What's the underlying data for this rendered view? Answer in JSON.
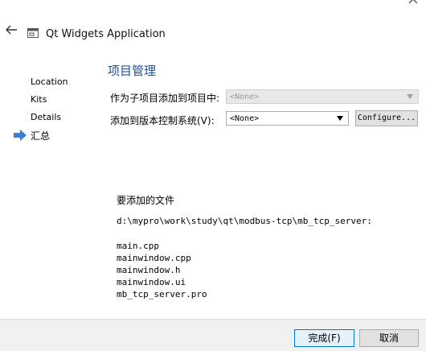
{
  "header": {
    "title": "Qt Widgets Application",
    "back_icon": "back-arrow-icon",
    "app_icon": "app-window-icon"
  },
  "sidebar": {
    "items": [
      {
        "label": "Location"
      },
      {
        "label": "Kits"
      },
      {
        "label": "Details"
      },
      {
        "label": "汇总"
      }
    ]
  },
  "main": {
    "title": "项目管理",
    "subproject_label": "作为子项目添加到项目中:",
    "subproject_value": "<None>",
    "vcs_label": "添加到版本控制系统(V):",
    "vcs_value": "<None>",
    "configure_label": "Configure...",
    "summary_heading": "要添加的文件",
    "summary_path": "d:\\mypro\\work\\study\\qt\\modbus-tcp\\mb_tcp_server:",
    "files": [
      "main.cpp",
      "mainwindow.cpp",
      "mainwindow.h",
      "mainwindow.ui",
      "mb_tcp_server.pro"
    ]
  },
  "footer": {
    "finish_label": "完成(F)",
    "cancel_label": "取消"
  },
  "colors": {
    "title": "#1f4e9a",
    "current_arrow": "#3b7fd6",
    "footer_bg": "#f0f0f0"
  }
}
